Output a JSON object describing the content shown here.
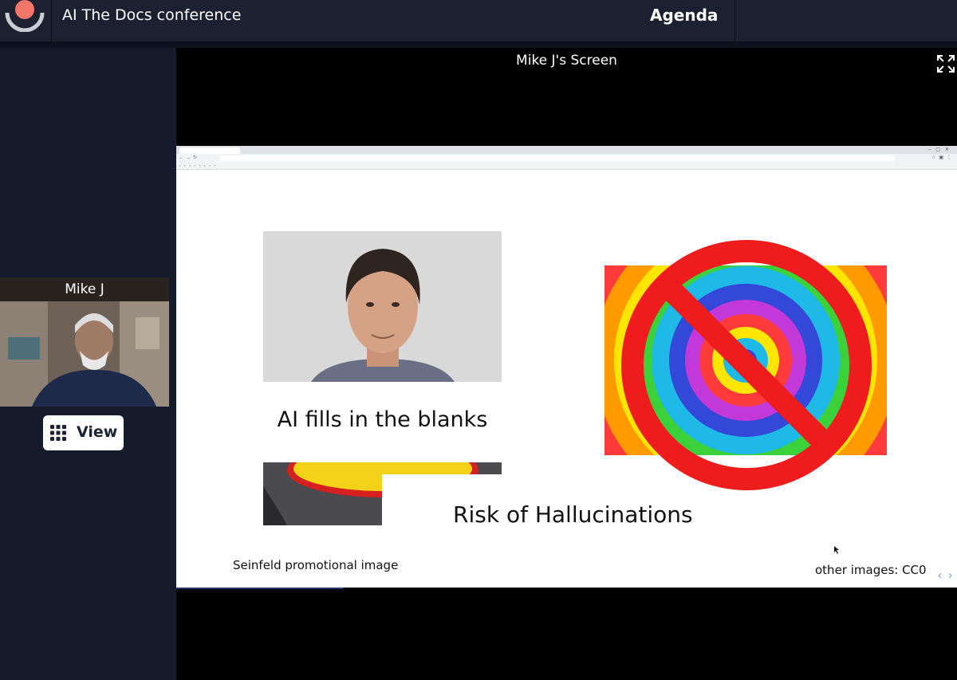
{
  "topbar": {
    "conference_title": "AI The Docs conference",
    "agenda_label": "Agenda"
  },
  "participant": {
    "name": "Mike J"
  },
  "view_button": {
    "label": "View"
  },
  "share": {
    "title": "Mike J's Screen"
  },
  "slide": {
    "left_heading": "AI fills in the blanks",
    "right_heading": "Risk of Hallucinations",
    "caption_left": "Seinfeld promotional image",
    "caption_right": "other images: CC0"
  },
  "colors": {
    "background": "#151b2b",
    "topbar": "#1b2131",
    "logo_coral": "#f4766b",
    "no_sign_red": "#ee1c1c"
  }
}
